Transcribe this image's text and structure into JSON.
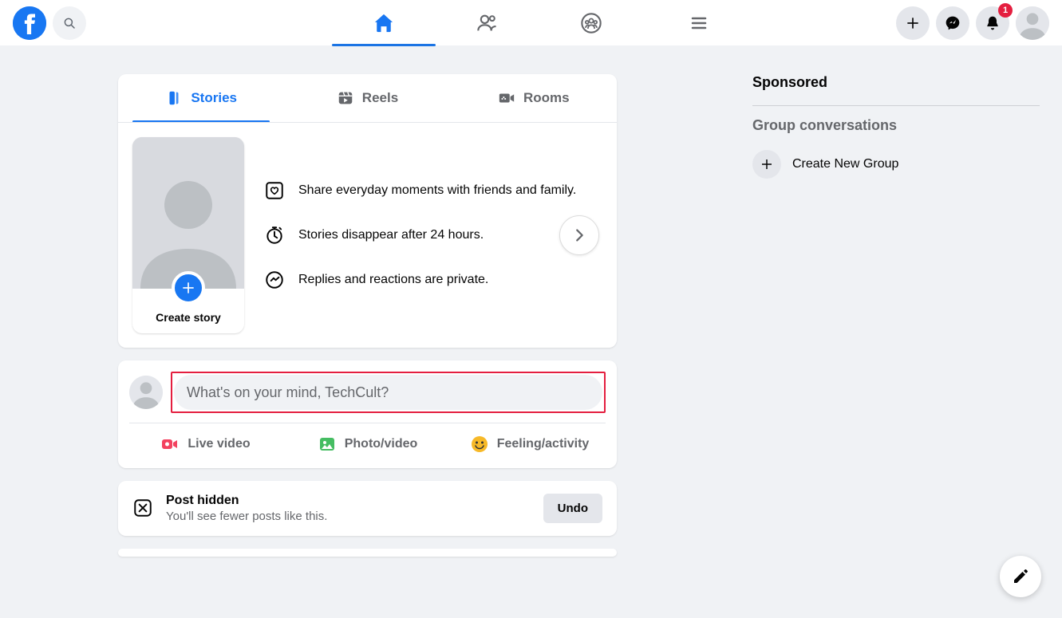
{
  "notifications_badge": "1",
  "stories": {
    "tabs": {
      "stories": "Stories",
      "reels": "Reels",
      "rooms": "Rooms"
    },
    "create_label": "Create story",
    "info": [
      "Share everyday moments with friends and family.",
      "Stories disappear after 24 hours.",
      "Replies and reactions are private."
    ]
  },
  "composer": {
    "placeholder": "What's on your mind, TechCult?",
    "live": "Live video",
    "photo": "Photo/video",
    "feeling": "Feeling/activity"
  },
  "hidden_post": {
    "title": "Post hidden",
    "subtitle": "You'll see fewer posts like this.",
    "undo": "Undo"
  },
  "right": {
    "sponsored": "Sponsored",
    "group_convos": "Group conversations",
    "create_group": "Create New Group"
  }
}
